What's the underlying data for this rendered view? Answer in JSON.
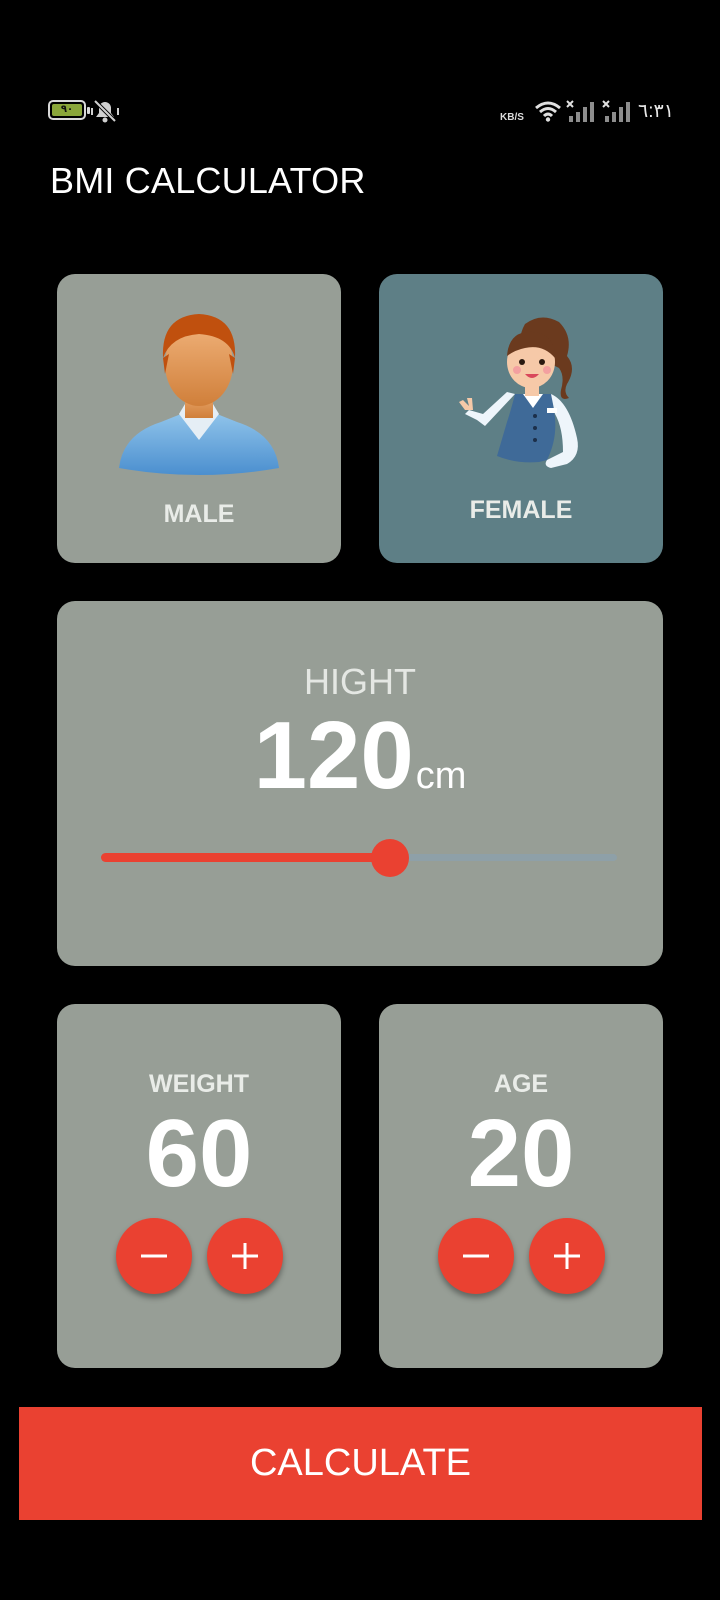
{
  "status_bar": {
    "battery_level": "٩٠",
    "network_speed": "KB/S",
    "time": "٦:٣١",
    "icons": [
      "battery-icon",
      "mute-vibrate-icon",
      "wifi-icon",
      "signal-icon",
      "signal-icon"
    ]
  },
  "app": {
    "title": "BMI CALCULATOR"
  },
  "gender": {
    "male_label": "MALE",
    "female_label": "FEMALE",
    "selected": "FEMALE"
  },
  "height": {
    "title": "HIGHT",
    "value": "120",
    "unit": "cm",
    "slider_fraction": 0.56
  },
  "weight": {
    "title": "WEIGHT",
    "value": "60"
  },
  "age": {
    "title": "AGE",
    "value": "20"
  },
  "calculate": {
    "label": "CALCULATE"
  },
  "colors": {
    "background": "#000000",
    "card": "#979e96",
    "card_selected": "#5e7f86",
    "accent": "#ea4131",
    "slider_inactive": "#8ea0a8"
  }
}
